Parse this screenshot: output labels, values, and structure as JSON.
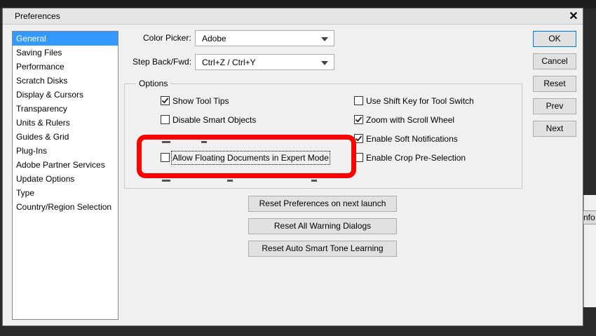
{
  "dialog": {
    "title": "Preferences",
    "close_label": "✕"
  },
  "categories": [
    "General",
    "Saving Files",
    "Performance",
    "Scratch Disks",
    "Display & Cursors",
    "Transparency",
    "Units & Rulers",
    "Guides & Grid",
    "Plug-Ins",
    "Adobe Partner Services",
    "Update Options",
    "Type",
    "Country/Region Selection"
  ],
  "selected_category": "General",
  "color_picker": {
    "label": "Color Picker:",
    "value": "Adobe"
  },
  "step_back": {
    "label": "Step Back/Fwd:",
    "value": "Ctrl+Z / Ctrl+Y"
  },
  "options": {
    "title": "Options",
    "show_tool_tips": {
      "label": "Show Tool Tips",
      "checked": true
    },
    "disable_smart_objects": {
      "label": "Disable Smart Objects",
      "checked": false
    },
    "allow_floating": {
      "label": "Allow Floating Documents in Expert Mode",
      "checked": false
    },
    "use_shift_key": {
      "label": "Use Shift Key for Tool Switch",
      "checked": false
    },
    "zoom_scroll": {
      "label": "Zoom with Scroll Wheel",
      "checked": true
    },
    "soft_notifications": {
      "label": "Enable Soft Notifications",
      "checked": true
    },
    "crop_preselection": {
      "label": "Enable Crop Pre-Selection",
      "checked": false
    }
  },
  "reset_buttons": {
    "reset_prefs": "Reset Preferences on next launch",
    "reset_warnings": "Reset All Warning Dialogs",
    "reset_smart_tone": "Reset Auto Smart Tone Learning"
  },
  "side_buttons": {
    "ok": "OK",
    "cancel": "Cancel",
    "reset": "Reset",
    "prev": "Prev",
    "next": "Next"
  },
  "background": {
    "partial_text": "nfo"
  },
  "colors": {
    "selection": "#3399ff",
    "highlight_box": "#ff0000",
    "dialog_bg": "#f0f0f0"
  }
}
